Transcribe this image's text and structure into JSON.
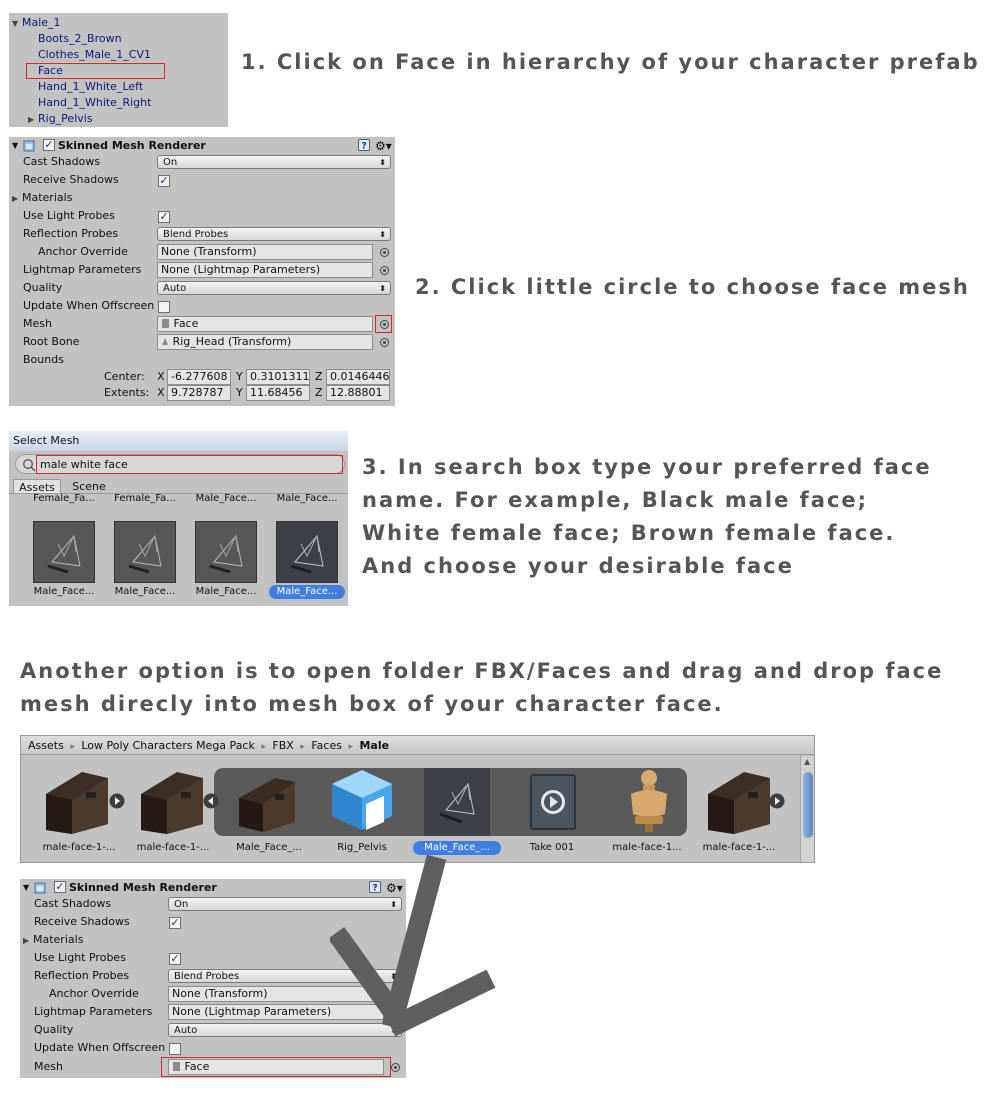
{
  "steps": {
    "s1": "1. Click on Face in hierarchy of your character prefab",
    "s2": "2. Click little circle to choose face mesh",
    "s3_l1": "3. In search box type your preferred face",
    "s3_l2": "name. For example, Black male face;",
    "s3_l3": "White female face; Brown female face.",
    "s3_l4": "And choose your desirable face",
    "alt_l1": "Another option is to open folder FBX/Faces and drag and drop face",
    "alt_l2": "mesh direcly into mesh box of your character face."
  },
  "hierarchy": {
    "root": "Male_1",
    "items": [
      "Boots_2_Brown",
      "Clothes_Male_1_CV1",
      "Face",
      "Hand_1_White_Left",
      "Hand_1_White_Right",
      "Rig_Pelvis"
    ]
  },
  "inspector": {
    "title": "Skinned Mesh Renderer",
    "cast_shadows_label": "Cast Shadows",
    "cast_shadows_value": "On",
    "receive_shadows_label": "Receive Shadows",
    "materials_label": "Materials",
    "light_probes_label": "Use Light Probes",
    "reflection_label": "Reflection Probes",
    "reflection_value": "Blend Probes",
    "anchor_label": "Anchor Override",
    "anchor_value": "None (Transform)",
    "lightmap_label": "Lightmap Parameters",
    "lightmap_value": "None (Lightmap Parameters)",
    "quality_label": "Quality",
    "quality_value": "Auto",
    "offscreen_label": "Update When Offscreen",
    "mesh_label": "Mesh",
    "mesh_value": "Face",
    "rootbone_label": "Root Bone",
    "rootbone_value": "Rig_Head (Transform)",
    "bounds_label": "Bounds",
    "center_label": "Center:",
    "extents_label": "Extents:",
    "x": "X",
    "y": "Y",
    "z": "Z",
    "center": [
      "-6.277608",
      "0.3101311",
      "0.0146446"
    ],
    "extents": [
      "9.728787",
      "11.68456",
      "12.88801"
    ]
  },
  "select_mesh": {
    "title": "Select Mesh",
    "search_value": "male white face",
    "tab_assets": "Assets",
    "tab_scene": "Scene",
    "top_labels": [
      "Female_Fa...",
      "Female_Fa...",
      "Male_Face...",
      "Male_Face..."
    ],
    "items": [
      "Male_Face...",
      "Male_Face...",
      "Male_Face...",
      "Male_Face..."
    ],
    "selected_index": 3
  },
  "project": {
    "crumbs": [
      "Assets",
      "Low Poly Characters Mega Pack",
      "FBX",
      "Faces",
      "Male"
    ],
    "sep": "▸",
    "items": [
      "male-face-1-...",
      "male-face-1-...",
      "Male_Face_...",
      "Rig_Pelvis",
      "Male_Face_...",
      "Take 001",
      "male-face-1...",
      "male-face-1-..."
    ],
    "selected_index": 4
  },
  "colors": {
    "step_text": "#555555",
    "highlight": "#d42a2a",
    "selection": "#3f7ee0",
    "panel": "#c2c2c2"
  }
}
